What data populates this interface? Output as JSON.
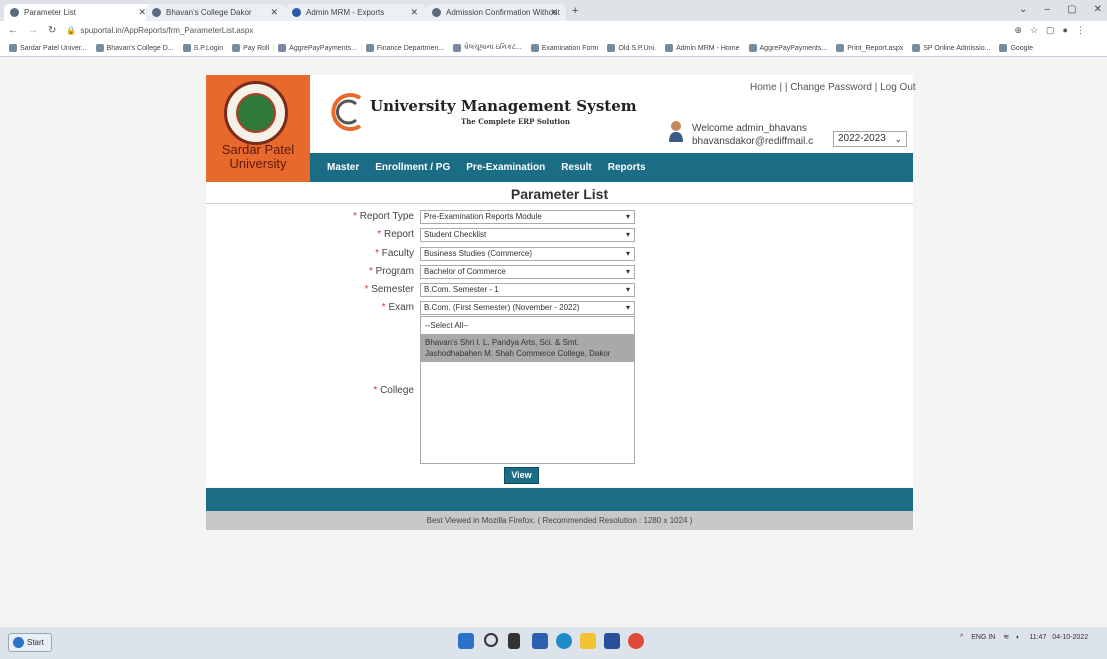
{
  "browser": {
    "tabs": [
      {
        "title": "Parameter List",
        "active": true
      },
      {
        "title": "Bhavan's College Dakor",
        "active": false
      },
      {
        "title": "Admin MRM - Exports",
        "active": false
      },
      {
        "title": "Admission Confirmation Without",
        "active": false
      }
    ],
    "new_tab": "+",
    "url": "spuportal.in/AppReports/frm_ParameterList.aspx",
    "bookmarks": [
      "Sardar Patel Univer...",
      "Bhavan's College D...",
      "S.P.Login",
      "Pay Roll",
      "AggrePayPayments...",
      "Finance Departmen...",
      "ઘેલચૂલાના ઇનિકટ...",
      "Examination Form",
      "Old S.P.Uni.",
      "Admin MRM - Home",
      "AggrePayPayments...",
      "Print_Report.aspx",
      "SP Online Admissio...",
      "Google"
    ]
  },
  "header": {
    "university_name": "Sardar Patel University",
    "system_title": "University Management System",
    "system_subtitle": "The Complete ERP Solution",
    "links": "Home | | Change Password | Log Out",
    "welcome": "Welcome admin_bhavans",
    "email": "bhavansdakor@rediffmail.c",
    "year": "2022-2023"
  },
  "nav": [
    "Master",
    "Enrollment / PG",
    "Pre-Examination",
    "Result",
    "Reports"
  ],
  "page_title": "Parameter List",
  "form": {
    "report_type": {
      "label": "Report Type",
      "value": "Pre-Examination Reports Module"
    },
    "report": {
      "label": "Report",
      "value": "Student Checklist"
    },
    "faculty": {
      "label": "Faculty",
      "value": "Business Studies (Commerce)"
    },
    "program": {
      "label": "Program",
      "value": "Bachelor of Commerce"
    },
    "semester": {
      "label": "Semester",
      "value": "B.Com. Semester - 1"
    },
    "exam": {
      "label": "Exam",
      "value": "B.Com. (First Semester) (November - 2022)"
    },
    "college": {
      "label": "College",
      "options": [
        "--Select All--",
        "Bhavan's Shri I. L. Pandya Arts, Sci. & Smt. Jashodhabahen M. Shah Commerce College, Dakor"
      ]
    },
    "required_mark": "*",
    "view_button": "View"
  },
  "footer": "Best Viewed in Mozilla Firefox. ( Recommended Resolution : 1280 x 1024 )",
  "taskbar": {
    "start": "Start",
    "lang": "ENG IN",
    "time": "11:47",
    "date": "04-10-2022"
  }
}
